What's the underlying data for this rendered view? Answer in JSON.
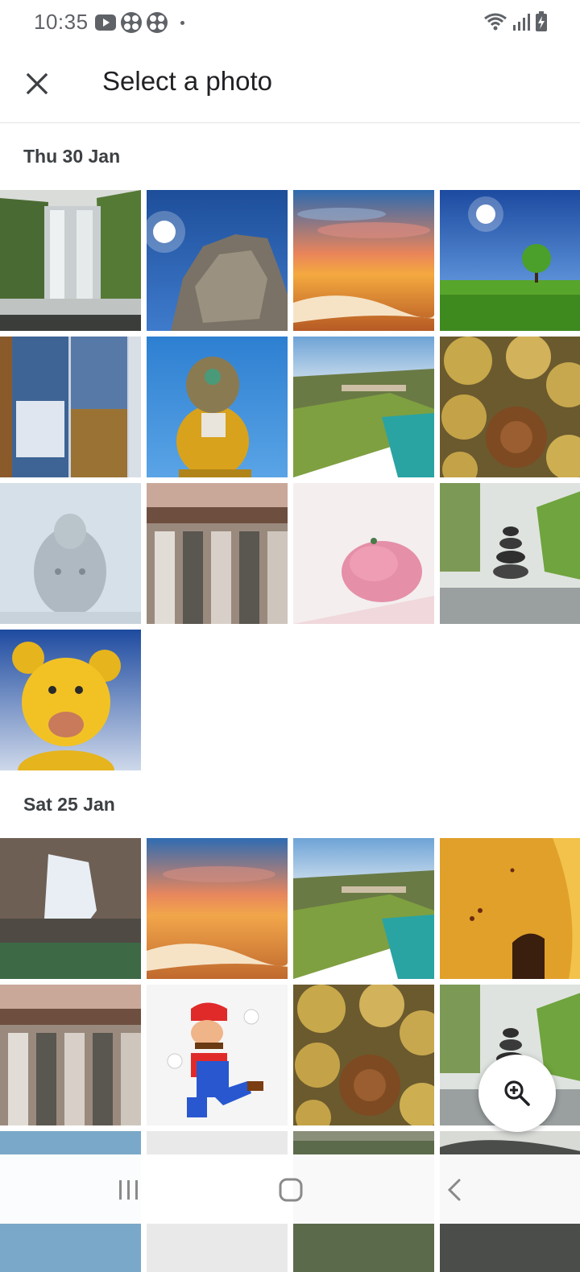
{
  "status_bar": {
    "time": "10:35",
    "left_icons": [
      "youtube-icon",
      "dice-app-icon",
      "dice-app-icon",
      "notification-dot-icon"
    ],
    "right_icons": [
      "wifi-icon",
      "signal-icon",
      "battery-charging-icon"
    ]
  },
  "header": {
    "title": "Select a photo",
    "close_icon": "close-icon"
  },
  "sections": [
    {
      "label": "Thu 30 Jan",
      "photos": [
        "waterfall",
        "rock-sky",
        "sunset-beach",
        "tree-field",
        "ice-collage",
        "toy-figure",
        "coastline-bridge",
        "roses",
        "buddha-statue",
        "carved-pillars",
        "pink-flower",
        "stone-stack",
        "yellow-toy"
      ]
    },
    {
      "label": "Sat 25 Jan",
      "photos": [
        "blurred-abstract",
        "sunset-beach",
        "coastline-bridge",
        "yellow-petals",
        "carved-pillars",
        "mario",
        "roses",
        "stone-stack",
        "sky-partial",
        "white-partial",
        "gravel-partial",
        "rock-partial"
      ]
    }
  ],
  "fab": {
    "icon": "zoom-in-icon"
  },
  "nav_bar": {
    "icons": [
      "recents-icon",
      "home-icon",
      "back-icon"
    ]
  },
  "colors": {
    "accent": "#202124",
    "label": "#3c4043",
    "divider": "#e3e3e3"
  }
}
